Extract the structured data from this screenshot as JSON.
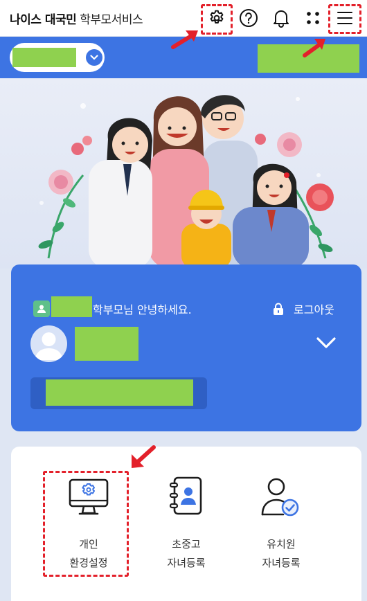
{
  "brand": {
    "bold": "나이스 대국민",
    "normal": "학부모서비스"
  },
  "toolbar": {
    "icons": [
      "gear-icon",
      "help-icon",
      "bell-icon",
      "apps-grid-icon",
      "menu-icon"
    ]
  },
  "user_card": {
    "greeting": "학부모님 안녕하세요.",
    "logout": "로그아웃"
  },
  "quick_menu": [
    {
      "line1": "개인",
      "line2": "환경설정",
      "icon": "monitor-gear-icon"
    },
    {
      "line1": "초중고",
      "line2": "자녀등록",
      "icon": "contact-book-icon"
    },
    {
      "line1": "유치원",
      "line2": "자녀등록",
      "icon": "user-check-icon"
    }
  ],
  "colors": {
    "primary": "#3d74e3",
    "primary_dark": "#2f5fc4",
    "redaction": "#8fd14f",
    "annotation": "#e3202a",
    "text": "#222222"
  }
}
